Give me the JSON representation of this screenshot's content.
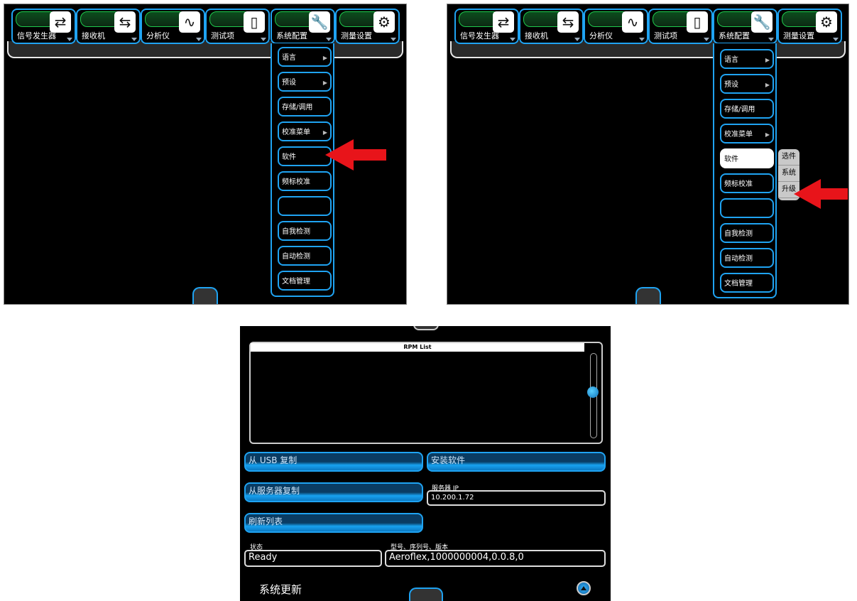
{
  "menubar": {
    "buttons": [
      {
        "label": "信号发生器",
        "icon": "signal-generator-icon"
      },
      {
        "label": "接收机",
        "icon": "receiver-icon"
      },
      {
        "label": "分析仪",
        "icon": "analyzer-icon"
      },
      {
        "label": "测试项",
        "icon": "test-items-icon"
      },
      {
        "label": "系统配置",
        "icon": "wrench-icon"
      },
      {
        "label": "测量设置",
        "icon": "gear-icon"
      }
    ]
  },
  "system_menu": {
    "items": [
      {
        "label": "语言",
        "has_submenu": true
      },
      {
        "label": "预设",
        "has_submenu": true
      },
      {
        "label": "存储/调用",
        "has_submenu": false
      },
      {
        "label": "校准菜单",
        "has_submenu": true
      },
      {
        "label": "软件",
        "has_submenu": false
      },
      {
        "label": "频标校准",
        "has_submenu": false
      },
      {
        "label": "",
        "has_submenu": false
      },
      {
        "label": "自我检测",
        "has_submenu": false
      },
      {
        "label": "自动检测",
        "has_submenu": false
      },
      {
        "label": "文档管理",
        "has_submenu": false
      }
    ],
    "submenu_glyph": "▶"
  },
  "software_submenu": {
    "items": [
      "选件",
      "系统",
      "升级"
    ]
  },
  "update_screen": {
    "rpm_list_title": "RPM List",
    "copy_usb_label": "从 USB 复制",
    "install_label": "安装软件",
    "copy_server_label": "从服务器复制",
    "server_ip_label": "服务器 IP",
    "server_ip_value": "10.200.1.72",
    "refresh_label": "刷新列表",
    "status_label": "状态",
    "status_value": "Ready",
    "model_label": "型号、序列号、版本",
    "model_value": "Aeroflex,1000000004,0.0.8,0",
    "title": "系统更新"
  },
  "colors": {
    "accent": "#1fa3f2",
    "highlight_arrow": "#e8141a",
    "background": "#000000"
  }
}
